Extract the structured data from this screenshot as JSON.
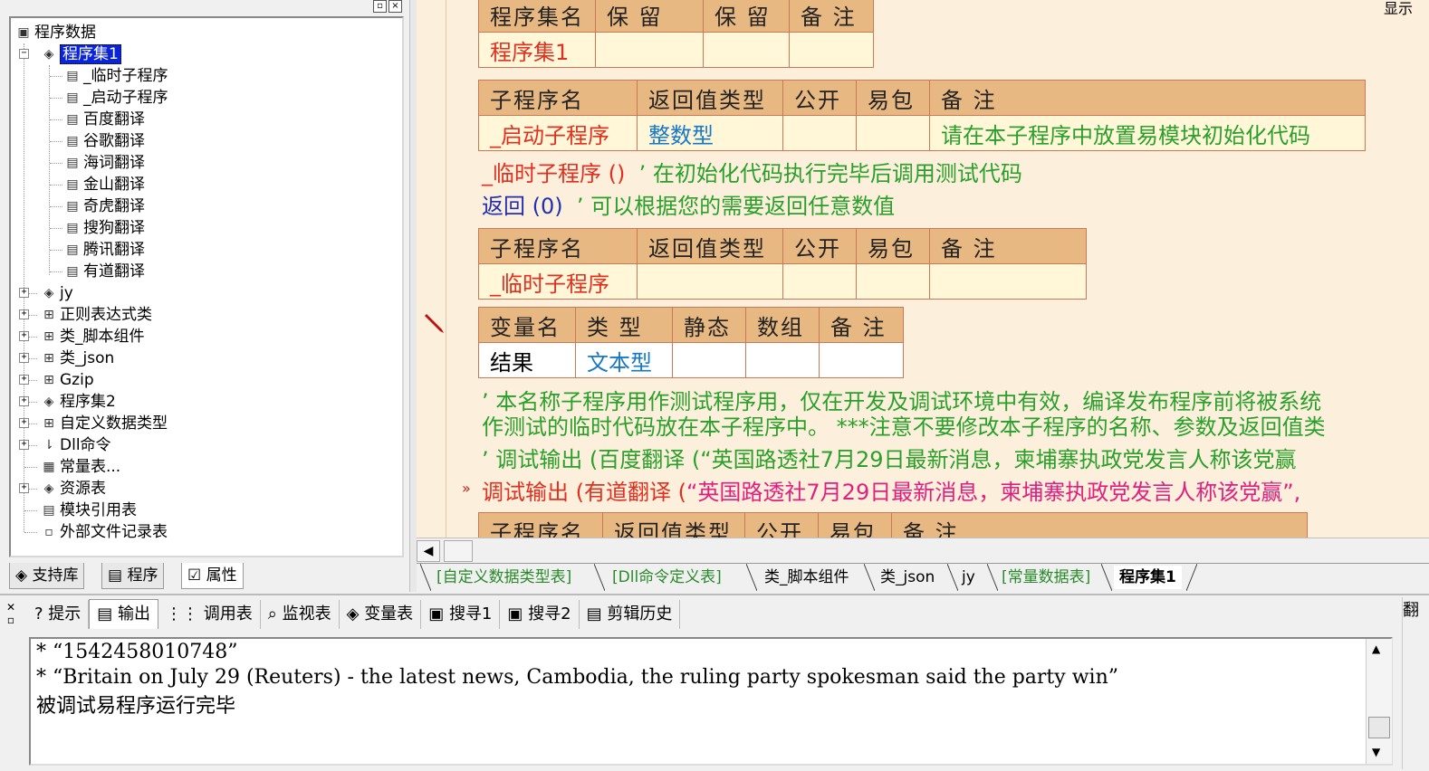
{
  "tree": {
    "root": "程序数据",
    "selected": "程序集1",
    "subroutines": [
      "_临时子程序",
      "_启动子程序",
      "百度翻译",
      "谷歌翻译",
      "海词翻译",
      "金山翻译",
      "奇虎翻译",
      "搜狗翻译",
      "腾讯翻译",
      "有道翻译"
    ],
    "others": [
      "jy",
      "正则表达式类",
      "类_脚本组件",
      "类_json",
      "Gzip",
      "程序集2",
      "自定义数据类型",
      "Dll命令",
      "常量表...",
      "资源表",
      "模块引用表",
      "外部文件记录表"
    ]
  },
  "left_tabs": [
    "支持库",
    "程序",
    "属性"
  ],
  "code": {
    "asm_header": [
      "程序集名",
      "保 留",
      "保 留",
      "备 注"
    ],
    "asm_name": "程序集1",
    "sub_header": [
      "子程序名",
      "返回值类型",
      "公开",
      "易包",
      "备 注"
    ],
    "sub1_name": "_启动子程序",
    "sub1_type": "整数型",
    "sub1_note": "请在本子程序中放置易模块初始化代码",
    "line1_call": "_临时子程序 ()",
    "line1_comment": "’ 在初始化代码执行完毕后调用测试代码",
    "line2_ret": "返回 (0)",
    "line2_comment": "’ 可以根据您的需要返回任意数值",
    "sub2_name": "_临时子程序",
    "var_header": [
      "变量名",
      "类 型",
      "静态",
      "数组",
      "备 注"
    ],
    "var_name": "结果",
    "var_type": "文本型",
    "comment_a": "’ 本名称子程序用作测试程序用，仅在开发及调试环境中有效，编译发布程序前将被系统",
    "comment_b": "作测试的临时代码放在本子程序中。 ***注意不要修改本子程序的名称、参数及返回值类",
    "comment_c": "’ 调试输出 (百度翻译 (“英国路透社7月29日最新消息，柬埔寨执政党发言人称该党赢",
    "debug_prefix": "调试输出 (有道翻译 (",
    "debug_string": "“英国路透社7月29日最新消息，柬埔寨执政党发言人称该党赢”,",
    "partial_header": [
      "子程序名",
      "返回值类型",
      "公开",
      "易包",
      "备 注"
    ]
  },
  "doc_tabs": [
    "[自定义数据类型表]",
    "[Dll命令定义表]",
    "类_脚本组件",
    "类_json",
    "jy",
    "[常量数据表]",
    "程序集1"
  ],
  "corner_label": "显示",
  "bottom_tabs": [
    "提示",
    "输出",
    "调用表",
    "监视表",
    "变量表",
    "搜寻1",
    "搜寻2",
    "剪辑历史"
  ],
  "output_lines": [
    "*  “1542458010748”",
    "*  “Britain on July 29 (Reuters) - the latest news, Cambodia, the ruling party spokesman said the party win”",
    "被调试易程序运行完毕"
  ],
  "right_edge_label": "翻"
}
